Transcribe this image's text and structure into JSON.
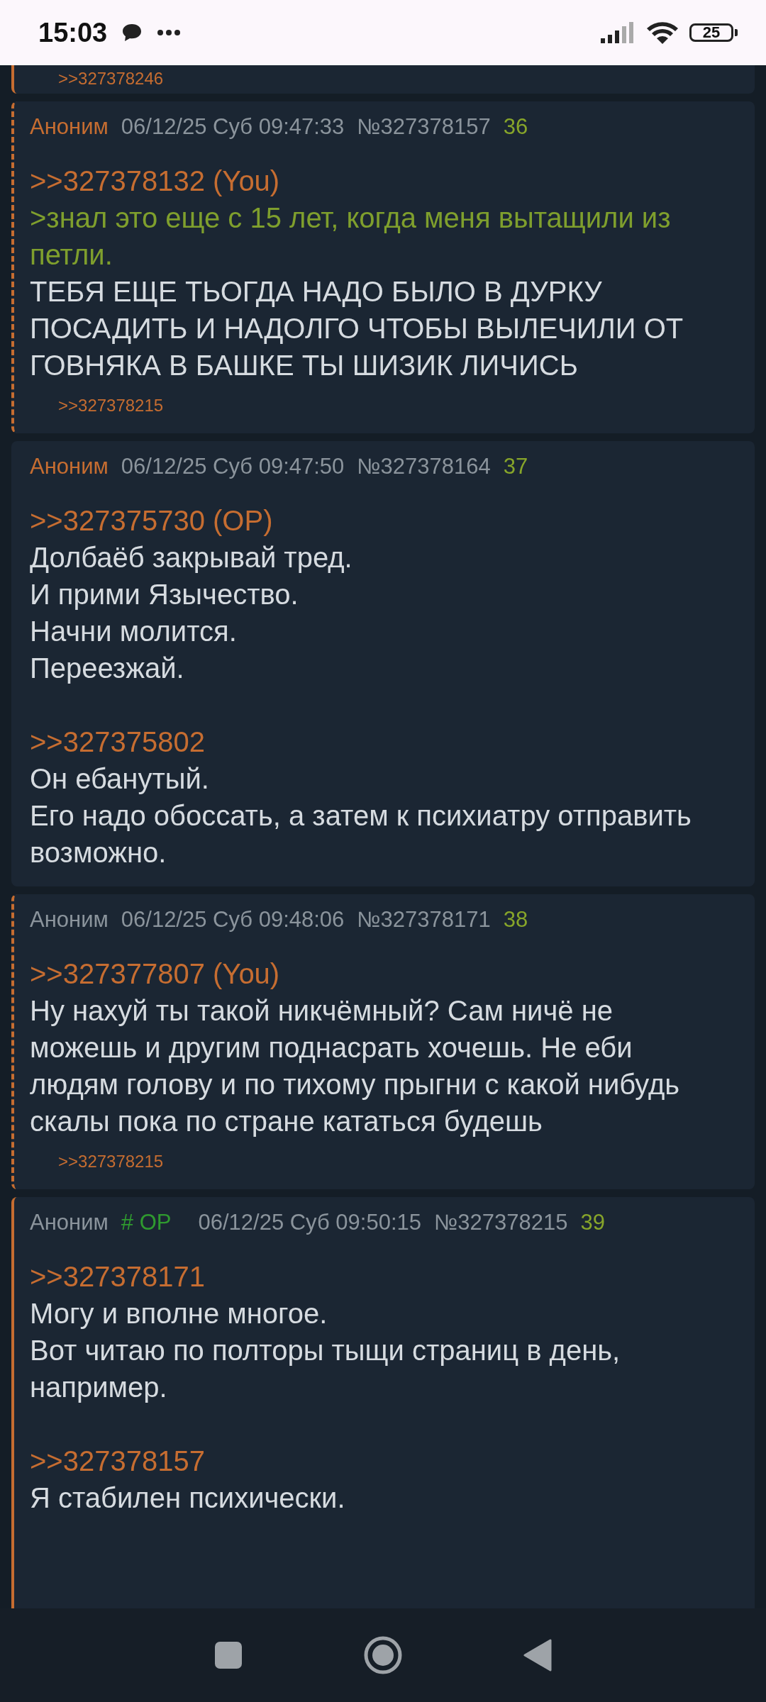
{
  "status_bar": {
    "time": "15:03",
    "battery": "25"
  },
  "posts": [
    {
      "highlighted": true,
      "dashed": false,
      "backlinks": [
        ">>327378246"
      ]
    },
    {
      "highlighted": true,
      "dashed": true,
      "name": "Аноним",
      "name_highlighted": true,
      "date": "06/12/25 Суб 09:47:33",
      "number": "№327378157",
      "count": "36",
      "paragraphs": [
        [
          {
            "kind": "reply",
            "text": ">>327378132 (You)"
          },
          {
            "kind": "quote",
            "text": ">знал это еще с 15 лет, когда меня вытащили из петли."
          },
          {
            "kind": "text",
            "text": "ТЕБЯ ЕЩЕ ТЬОГДА НАДО БЫЛО В ДУРКУ ПОСАДИТЬ И НАДОЛГО ЧТОБЫ ВЫЛЕЧИЛИ ОТ ГОВНЯКА В БАШКЕ ТЫ ШИЗИК ЛИЧИСЬ"
          }
        ]
      ],
      "backlinks": [
        ">>327378215"
      ]
    },
    {
      "highlighted": false,
      "name": "Аноним",
      "name_highlighted": true,
      "date": "06/12/25 Суб 09:47:50",
      "number": "№327378164",
      "count": "37",
      "paragraphs": [
        [
          {
            "kind": "reply",
            "text": ">>327375730 (OP)"
          },
          {
            "kind": "text",
            "text": "Долбаёб закрывай тред."
          },
          {
            "kind": "text",
            "text": "И прими Язычество."
          },
          {
            "kind": "text",
            "text": "Начни молится."
          },
          {
            "kind": "text",
            "text": "Переезжай."
          }
        ],
        [
          {
            "kind": "reply",
            "text": ">>327375802"
          },
          {
            "kind": "text",
            "text": "Он ебанутый."
          },
          {
            "kind": "text",
            "text": "Его надо обоссать, а затем к психиатру отправить возможно."
          }
        ]
      ]
    },
    {
      "highlighted": true,
      "dashed": true,
      "name": "Аноним",
      "name_highlighted": false,
      "date": "06/12/25 Суб 09:48:06",
      "number": "№327378171",
      "count": "38",
      "paragraphs": [
        [
          {
            "kind": "reply",
            "text": ">>327377807 (You)"
          },
          {
            "kind": "text",
            "text": "Ну нахуй ты такой никчёмный? Сам ничё не можешь и другим поднасрать хочешь. Не еби людям голову и по тихому прыгни с какой нибудь скалы пока по стране кататься будешь"
          }
        ]
      ],
      "backlinks": [
        ">>327378215"
      ]
    },
    {
      "highlighted": true,
      "dashed": false,
      "name": "Аноним",
      "name_highlighted": false,
      "tag": "# OP",
      "date": "06/12/25 Суб 09:50:15",
      "number": "№327378215",
      "count": "39",
      "paragraphs": [
        [
          {
            "kind": "reply",
            "text": ">>327378171"
          },
          {
            "kind": "text",
            "text": "Могу и вполне многое."
          },
          {
            "kind": "text",
            "text": "Вот читаю по полторы тыщи страниц в день, например."
          }
        ],
        [
          {
            "kind": "reply",
            "text": ">>327378157"
          },
          {
            "kind": "text",
            "text": "Я стабилен психически."
          }
        ]
      ]
    }
  ]
}
